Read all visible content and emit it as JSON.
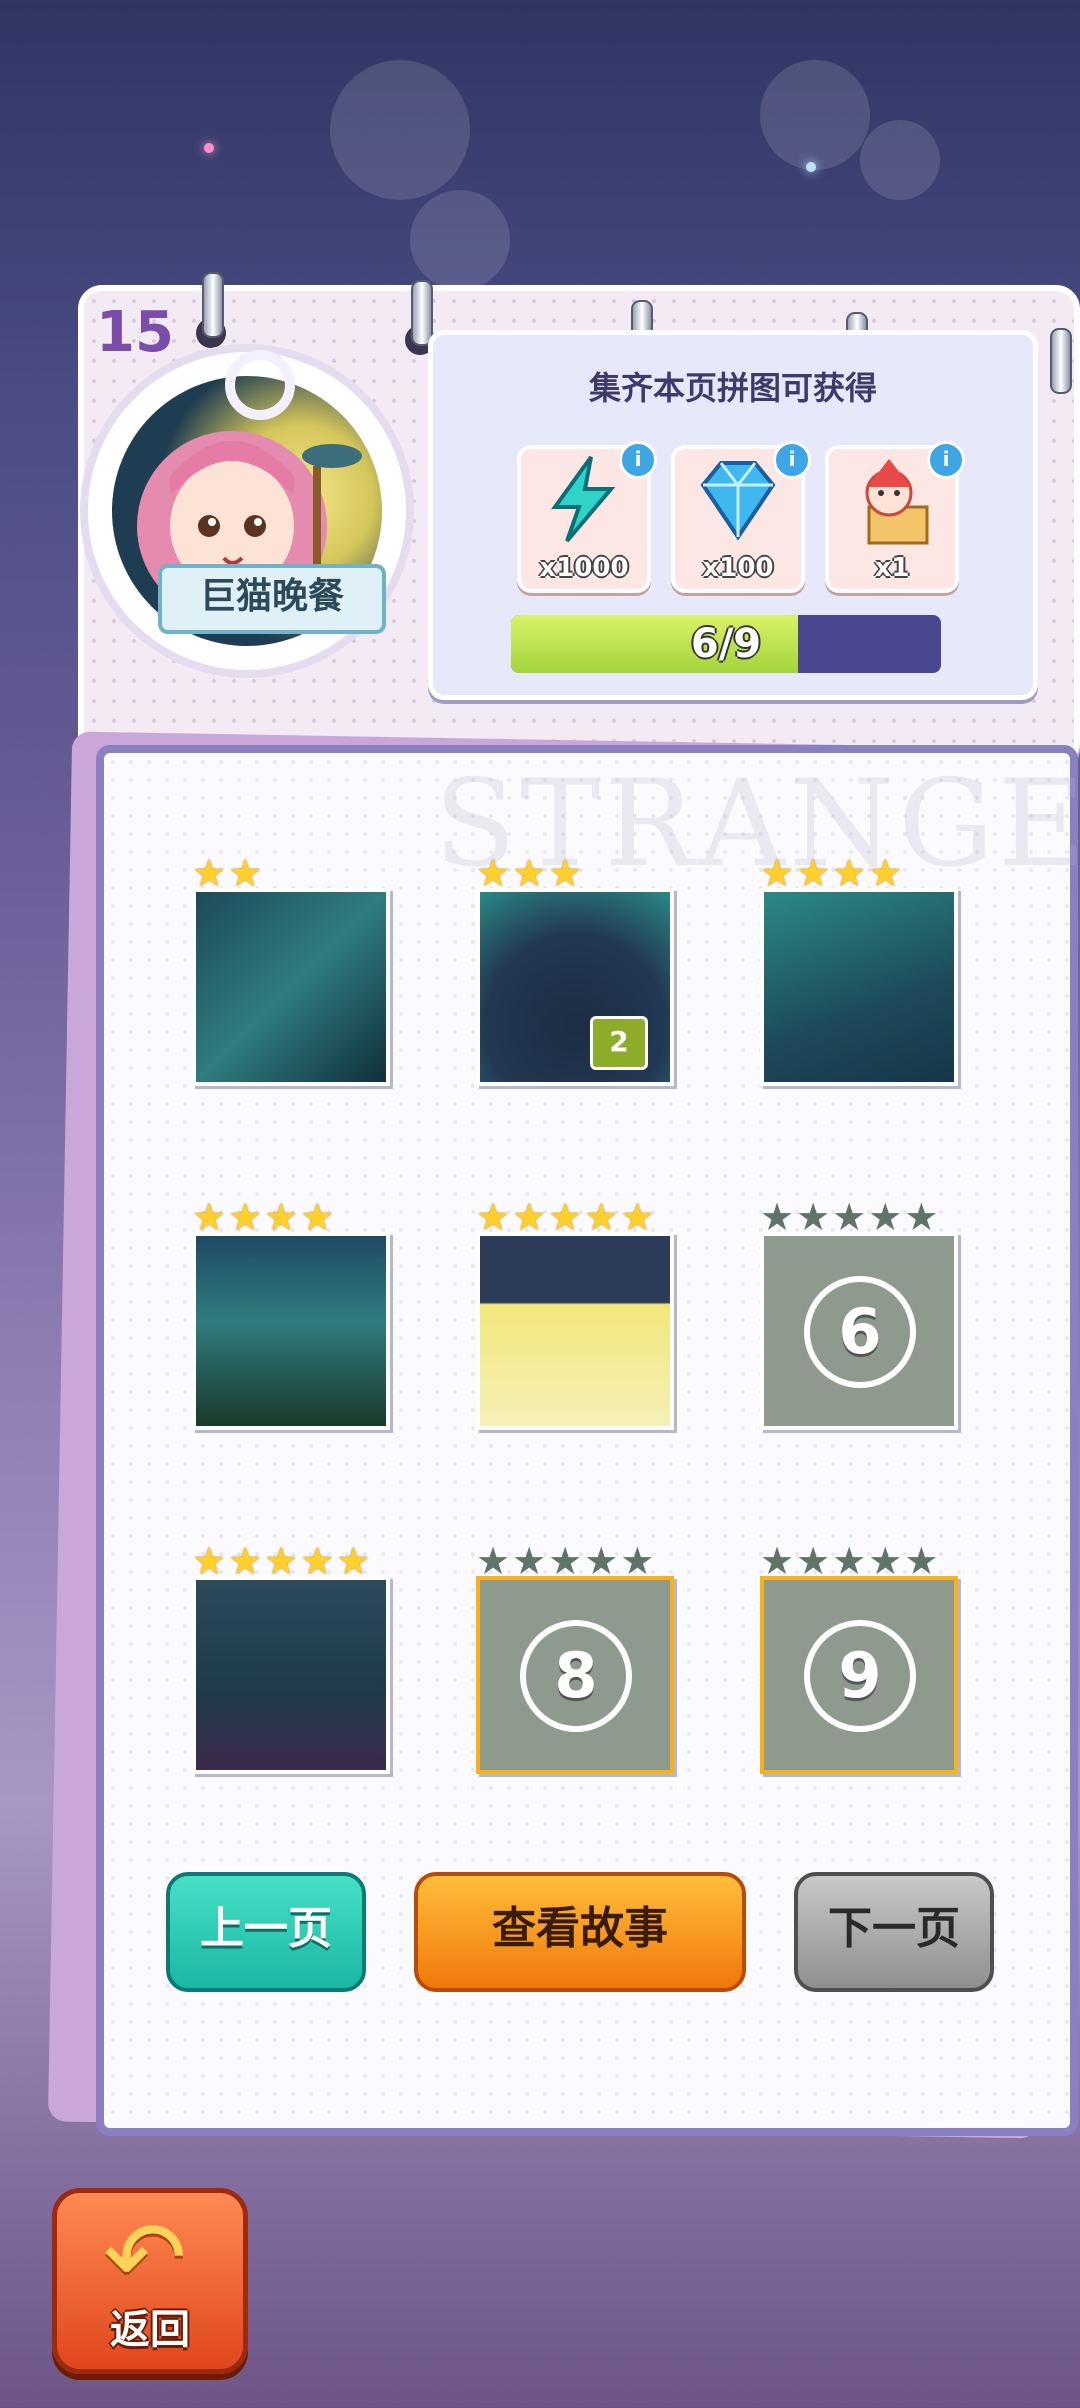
{
  "page_number": "15",
  "chapter": {
    "title": "巨猫晚餐"
  },
  "rewards": {
    "title": "集齐本页拼图可获得",
    "items": [
      {
        "icon": "lightning-icon",
        "amount": "x1000",
        "color": "#2fd3c8"
      },
      {
        "icon": "diamond-icon",
        "amount": "x100",
        "color": "#3fa6e6"
      },
      {
        "icon": "jester-box-icon",
        "amount": "x1",
        "color": "#e84a4a"
      }
    ],
    "progress": {
      "text": "6/9",
      "value": 6,
      "max": 9
    }
  },
  "watermark": "STRANGE",
  "pieces": [
    {
      "id": 1,
      "stars": 2,
      "unlocked": true,
      "badge": ""
    },
    {
      "id": 2,
      "stars": 3,
      "unlocked": true,
      "badge": "2"
    },
    {
      "id": 3,
      "stars": 4,
      "unlocked": true,
      "badge": ""
    },
    {
      "id": 4,
      "stars": 4,
      "unlocked": true,
      "badge": ""
    },
    {
      "id": 5,
      "stars": 5,
      "unlocked": true,
      "badge": ""
    },
    {
      "id": 6,
      "stars": 0,
      "unlocked": false,
      "label": "6"
    },
    {
      "id": 7,
      "stars": 5,
      "unlocked": true,
      "badge": ""
    },
    {
      "id": 8,
      "stars": 0,
      "unlocked": false,
      "label": "8"
    },
    {
      "id": 9,
      "stars": 0,
      "unlocked": false,
      "label": "9"
    }
  ],
  "buttons": {
    "prev": "上一页",
    "story": "查看故事",
    "next": "下一页"
  },
  "back": {
    "label": "返回"
  }
}
